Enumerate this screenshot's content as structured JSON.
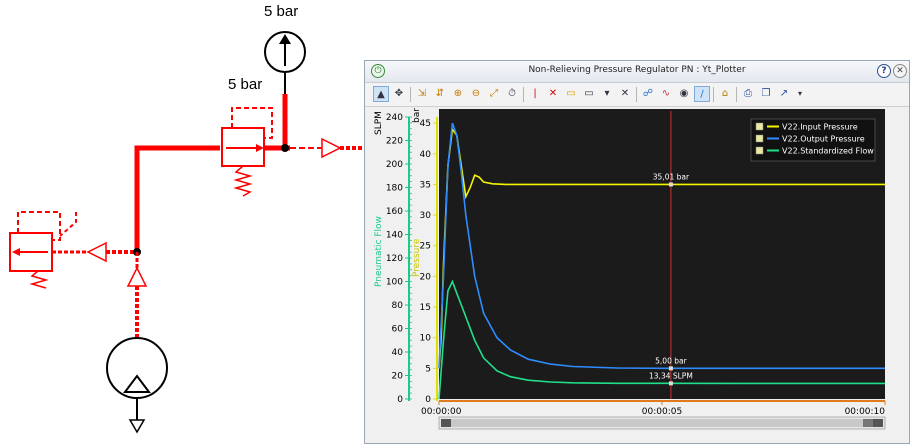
{
  "schematic": {
    "gauge_top_label": "5 bar",
    "gauge_mid_label": "5 bar"
  },
  "window": {
    "title": "Non-Relieving Pressure Regulator PN : Yt_Plotter",
    "help_label": "?",
    "close_label": "✕"
  },
  "toolbar": {
    "icons": [
      "select-icon",
      "pan-icon",
      "zoom-x-icon",
      "zoom-y-icon",
      "zoom-in-icon",
      "zoom-out-icon",
      "zoom-fit-icon",
      "timer-icon",
      "cursor-add-icon",
      "cursor-delete-icon",
      "marker-add-icon",
      "marker-delete-icon",
      "dropdown-icon",
      "delete-icon",
      "visibility-icon",
      "eye-icon",
      "curve-icon",
      "lock-icon",
      "print-icon",
      "copy-icon",
      "export-icon",
      "overflow-icon"
    ]
  },
  "colors": {
    "plot_bg": "#1b1b1b",
    "input_pressure": "#f5f500",
    "output_pressure": "#2f8cff",
    "standardized_flow": "#1fe08a",
    "cursor_line": "#cc3333",
    "flow_axis": "#1fc98a",
    "pressure_axis": "#e0e000",
    "time_axis": "#e07a1f",
    "circuit_red": "#ff0000"
  },
  "chart_data": {
    "type": "line",
    "xlabel": "",
    "x_tick_labels": [
      "00:00:00",
      "00:00:05",
      "00:00:10"
    ],
    "xlim": [
      0,
      10
    ],
    "left_axis": {
      "title": "Pneumatic Flow",
      "unit": "SLPM",
      "ticks": [
        "0",
        "20",
        "40",
        "60",
        "80",
        "100",
        "120",
        "140",
        "160",
        "180",
        "200",
        "220",
        "240"
      ],
      "ylim": [
        0,
        240
      ]
    },
    "right_axis": {
      "title": "Pressure",
      "unit": "bar",
      "ticks": [
        "0",
        "5",
        "10",
        "15",
        "20",
        "25",
        "30",
        "35",
        "40",
        "45"
      ],
      "ylim": [
        0,
        46
      ]
    },
    "series": [
      {
        "name": "V22.Input Pressure",
        "axis": "pressure",
        "x": [
          0,
          0.05,
          0.1,
          0.2,
          0.3,
          0.4,
          0.5,
          0.6,
          0.7,
          0.8,
          0.9,
          1.0,
          1.2,
          1.5,
          2,
          3,
          5,
          7,
          10
        ],
        "y": [
          5,
          10,
          22,
          38,
          44,
          43,
          38,
          33,
          34.5,
          36.5,
          36.2,
          35.4,
          35.1,
          35.0,
          35.0,
          35.0,
          35.0,
          35.0,
          35.0
        ]
      },
      {
        "name": "V22.Output Pressure",
        "axis": "pressure",
        "x": [
          0,
          0.1,
          0.2,
          0.3,
          0.4,
          0.5,
          0.6,
          0.8,
          1.0,
          1.3,
          1.6,
          2,
          2.5,
          3,
          4,
          5,
          7,
          10
        ],
        "y": [
          5,
          20,
          38,
          45,
          43,
          37,
          30,
          20,
          14,
          10,
          8,
          6.5,
          5.7,
          5.3,
          5.05,
          5.0,
          5.0,
          5.0
        ]
      },
      {
        "name": "V22.Standardized Flow",
        "axis": "flow",
        "x": [
          0,
          0.1,
          0.2,
          0.3,
          0.4,
          0.5,
          0.6,
          0.8,
          1.0,
          1.3,
          1.6,
          2,
          2.5,
          3,
          4,
          5,
          7,
          10
        ],
        "y": [
          0,
          50,
          92,
          100,
          90,
          80,
          70,
          50,
          35,
          24,
          19,
          16,
          14.5,
          13.8,
          13.4,
          13.34,
          13.3,
          13.3
        ]
      }
    ],
    "cursor": {
      "x": 5.2,
      "labels": [
        {
          "series": "V22.Input Pressure",
          "text": "35,01 bar"
        },
        {
          "series": "V22.Output Pressure",
          "text": "5,00 bar"
        },
        {
          "series": "V22.Standardized Flow",
          "text": "13,34 SLPM"
        }
      ]
    },
    "legend": "top-right",
    "grid": false
  }
}
